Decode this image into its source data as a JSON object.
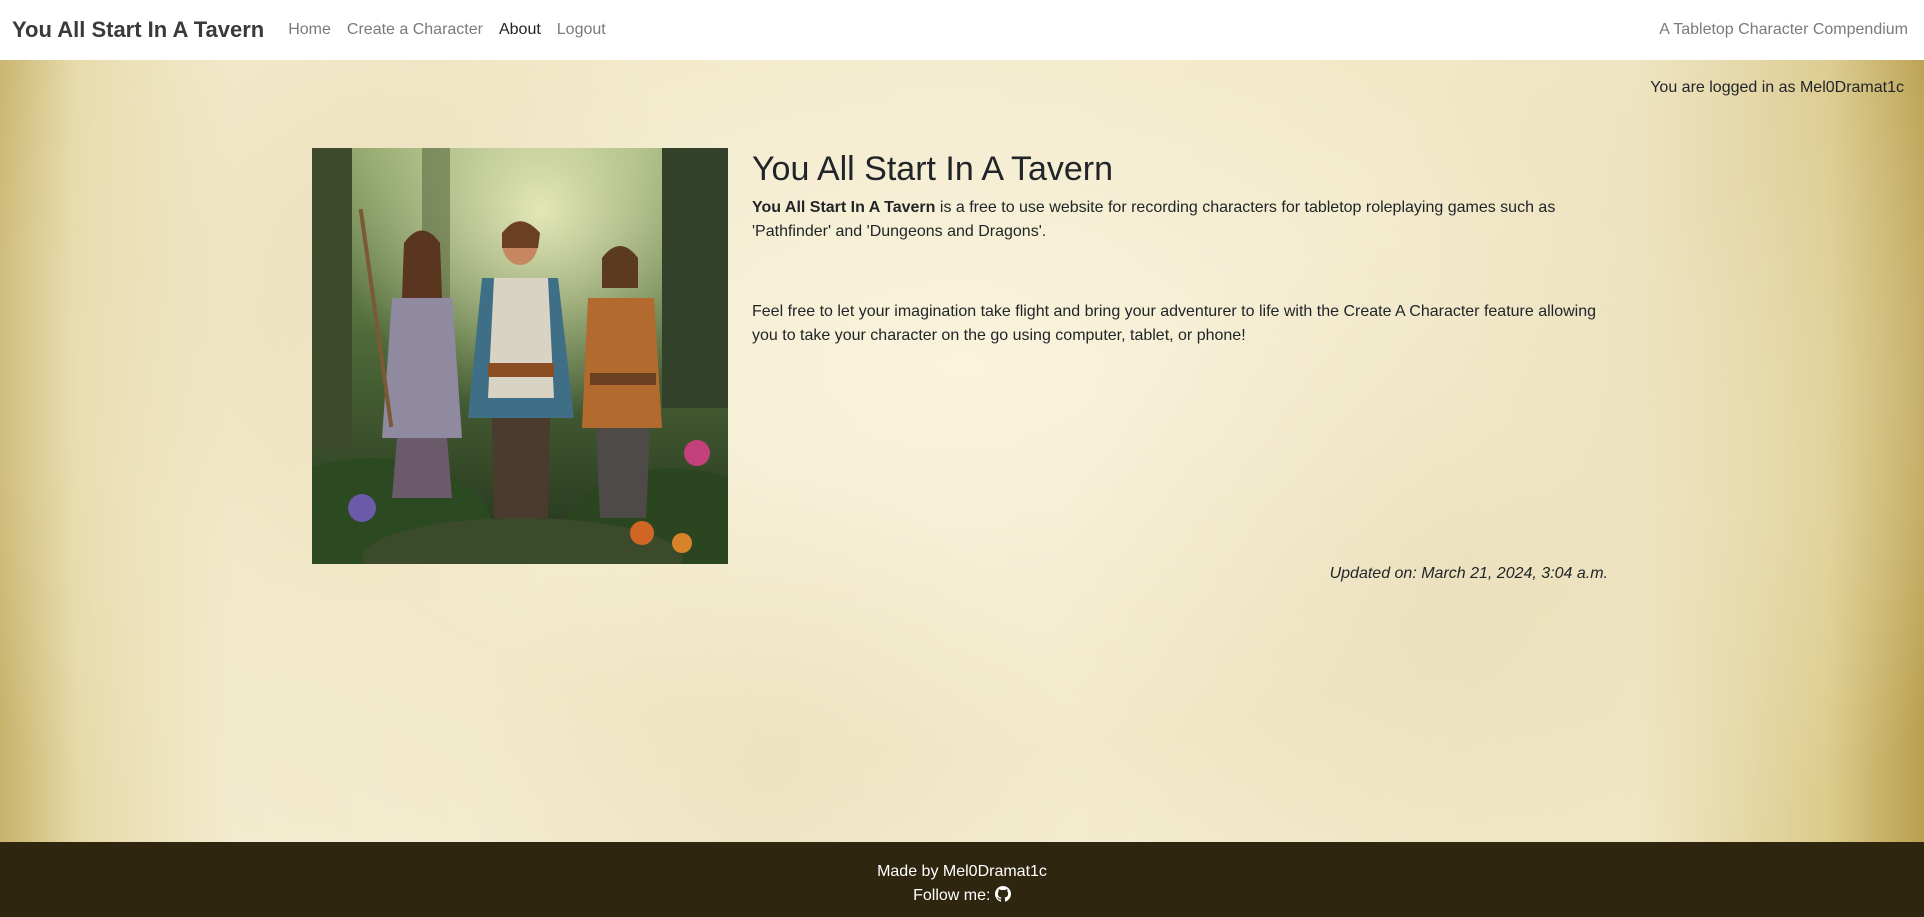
{
  "navbar": {
    "brand": "You All Start In A Tavern",
    "links": [
      {
        "label": "Home"
      },
      {
        "label": "Create a Character"
      },
      {
        "label": "About"
      },
      {
        "label": "Logout"
      }
    ],
    "tagline": "A Tabletop Character Compendium"
  },
  "status": {
    "logged_in_text": "You are logged in as Mel0Dramat1c"
  },
  "main": {
    "title": "You All Start In A Tavern",
    "intro_bold": "You All Start In A Tavern",
    "intro_rest": " is a free to use website for recording characters for tabletop roleplaying games such as 'Pathfinder' and 'Dungeons and Dragons'.",
    "paragraph": "Feel free to let your imagination take flight and bring your adventurer to life with the Create A Character feature allowing you to take your character on the go using computer, tablet, or phone!",
    "updated": "Updated on: March 21, 2024, 3:04 a.m."
  },
  "footer": {
    "made_by": "Made by Mel0Dramat1c",
    "follow": "Follow me:",
    "icon": "github-icon"
  },
  "colors": {
    "footer_bg": "#2f2610",
    "navbar_bg": "#ffffff",
    "nav_link": "#7a7a7a",
    "nav_active": "#212529"
  }
}
